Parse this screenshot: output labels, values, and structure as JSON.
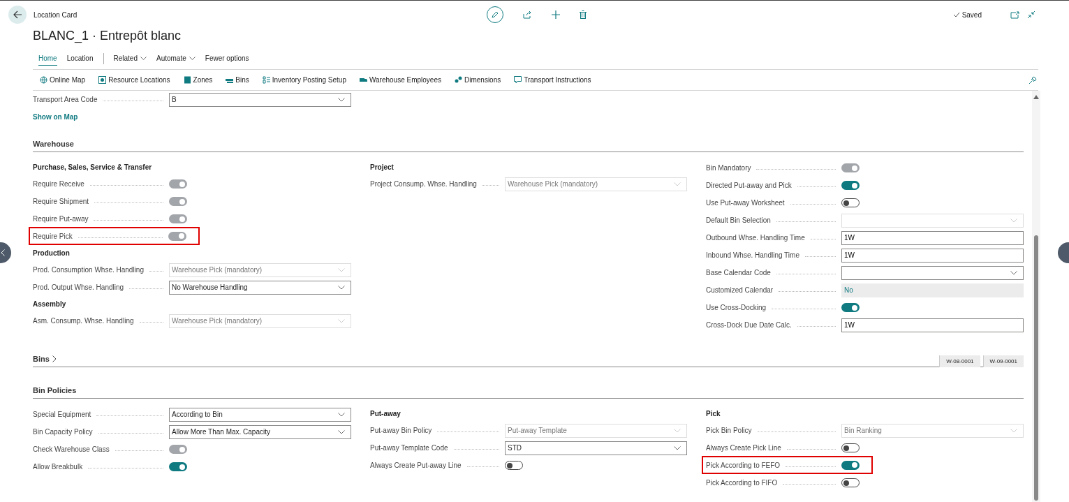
{
  "header": {
    "breadcrumb": "Location Card",
    "title": "BLANC_1 · Entrepôt blanc",
    "status": "Saved"
  },
  "tabs": [
    {
      "label": "Home",
      "selected": true,
      "dropdown": false
    },
    {
      "label": "Location",
      "selected": false,
      "dropdown": false
    },
    {
      "label": "Related",
      "selected": false,
      "dropdown": true
    },
    {
      "label": "Automate",
      "selected": false,
      "dropdown": true
    },
    {
      "label": "Fewer options",
      "selected": false,
      "dropdown": false
    }
  ],
  "actions": [
    {
      "label": "Online Map"
    },
    {
      "label": "Resource Locations"
    },
    {
      "label": "Zones"
    },
    {
      "label": "Bins"
    },
    {
      "label": "Inventory Posting Setup"
    },
    {
      "label": "Warehouse Employees"
    },
    {
      "label": "Dimensions"
    },
    {
      "label": "Transport Instructions"
    }
  ],
  "top_fields": [
    {
      "label": "Transport Area Code",
      "kind": "select",
      "value": "B",
      "disabled": false,
      "highlighted": false
    }
  ],
  "top_link": "Show on Map",
  "sections": [
    {
      "title": "Warehouse",
      "expanded": true,
      "columns": [
        [
          {
            "title": "Purchase, Sales, Service & Transfer",
            "fields": [
              {
                "label": "Require Receive",
                "kind": "toggle",
                "on": true,
                "disabled": true,
                "highlighted": false
              },
              {
                "label": "Require Shipment",
                "kind": "toggle",
                "on": true,
                "disabled": true,
                "highlighted": false
              },
              {
                "label": "Require Put-away",
                "kind": "toggle",
                "on": true,
                "disabled": true,
                "highlighted": false
              },
              {
                "label": "Require Pick",
                "kind": "toggle",
                "on": true,
                "disabled": true,
                "highlighted": true
              }
            ]
          },
          {
            "title": "Production",
            "fields": [
              {
                "label": "Prod. Consumption Whse. Handling",
                "kind": "select",
                "value": "Warehouse Pick (mandatory)",
                "disabled": true,
                "highlighted": false
              },
              {
                "label": "Prod. Output Whse. Handling",
                "kind": "select",
                "value": "No Warehouse Handling",
                "disabled": false,
                "highlighted": false
              }
            ]
          },
          {
            "title": "Assembly",
            "fields": [
              {
                "label": "Asm. Consump. Whse. Handling",
                "kind": "select",
                "value": "Warehouse Pick (mandatory)",
                "disabled": true,
                "highlighted": false
              }
            ]
          }
        ],
        [
          {
            "title": "Project",
            "fields": [
              {
                "label": "Project Consump. Whse. Handling",
                "kind": "select",
                "value": "Warehouse Pick (mandatory)",
                "disabled": true,
                "highlighted": false
              }
            ]
          }
        ],
        [
          {
            "fields": [
              {
                "label": "Bin Mandatory",
                "kind": "toggle",
                "on": true,
                "disabled": true,
                "highlighted": false
              },
              {
                "label": "Directed Put-away and Pick",
                "kind": "toggle",
                "on": true,
                "disabled": false,
                "highlighted": false
              },
              {
                "label": "Use Put-away Worksheet",
                "kind": "toggle",
                "on": false,
                "highlighted": false
              },
              {
                "label": "Default Bin Selection",
                "kind": "select",
                "disabled": true,
                "highlighted": false
              },
              {
                "label": "Outbound Whse. Handling Time",
                "kind": "input",
                "value": "1W",
                "highlighted": false
              },
              {
                "label": "Inbound Whse. Handling Time",
                "kind": "input",
                "value": "1W",
                "highlighted": false
              },
              {
                "label": "Base Calendar Code",
                "kind": "select",
                "disabled": false,
                "highlighted": false
              },
              {
                "label": "Customized Calendar",
                "kind": "readonly",
                "value": "No",
                "highlighted": false
              },
              {
                "label": "Use Cross-Docking",
                "kind": "toggle",
                "on": true,
                "disabled": false,
                "highlighted": false
              },
              {
                "label": "Cross-Dock Due Date Calc.",
                "kind": "input",
                "value": "1W",
                "highlighted": false
              }
            ]
          }
        ]
      ]
    },
    {
      "title": "Bins",
      "expanded": false,
      "chips": [
        "W-08-0001",
        "W-09-0001"
      ]
    },
    {
      "title": "Bin Policies",
      "expanded": true,
      "columns": [
        [
          {
            "fields": [
              {
                "label": "Special Equipment",
                "kind": "select",
                "value": "According to Bin",
                "disabled": false,
                "highlighted": false
              },
              {
                "label": "Bin Capacity Policy",
                "kind": "select",
                "value": "Allow More Than Max. Capacity",
                "disabled": false,
                "highlighted": false
              },
              {
                "label": "Check Warehouse Class",
                "kind": "toggle",
                "on": true,
                "disabled": true,
                "highlighted": false
              },
              {
                "label": "Allow Breakbulk",
                "kind": "toggle",
                "on": true,
                "disabled": false,
                "highlighted": false
              }
            ]
          }
        ],
        [
          {
            "title": "Put-away",
            "fields": [
              {
                "label": "Put-away Bin Policy",
                "kind": "select",
                "value": "Put-away Template",
                "disabled": true,
                "highlighted": false
              },
              {
                "label": "Put-away Template Code",
                "kind": "select",
                "value": "STD",
                "disabled": false,
                "highlighted": false
              },
              {
                "label": "Always Create Put-away Line",
                "kind": "toggle",
                "on": false,
                "highlighted": false
              }
            ]
          }
        ],
        [
          {
            "title": "Pick",
            "fields": [
              {
                "label": "Pick Bin Policy",
                "kind": "select",
                "value": "Bin Ranking",
                "disabled": true,
                "highlighted": false
              },
              {
                "label": "Always Create Pick Line",
                "kind": "toggle",
                "on": false,
                "highlighted": false
              },
              {
                "label": "Pick According to FEFO",
                "kind": "toggle",
                "on": true,
                "disabled": false,
                "highlighted": true
              },
              {
                "label": "Pick According to FIFO",
                "kind": "toggle",
                "on": false,
                "highlighted": false
              }
            ]
          }
        ]
      ]
    }
  ]
}
